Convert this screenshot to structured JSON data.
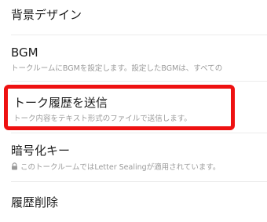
{
  "settings": {
    "background_design": {
      "title": "背景デザイン"
    },
    "bgm": {
      "title": "BGM",
      "description": "トークルームにBGMを設定します。設定したBGMは、すべての"
    },
    "send_history": {
      "title": "トーク履歴を送信",
      "description": "トーク内容をテキスト形式のファイルで送信します。"
    },
    "encryption_key": {
      "title": "暗号化キー",
      "description": "このトークルームではLetter Sealingが適用されています。",
      "icon": "lock-icon"
    },
    "delete_history": {
      "title": "履歴削除"
    }
  },
  "colors": {
    "highlight_border": "#ee1111",
    "title_text": "#1c1c1c",
    "description_text": "#9a9a9a"
  }
}
